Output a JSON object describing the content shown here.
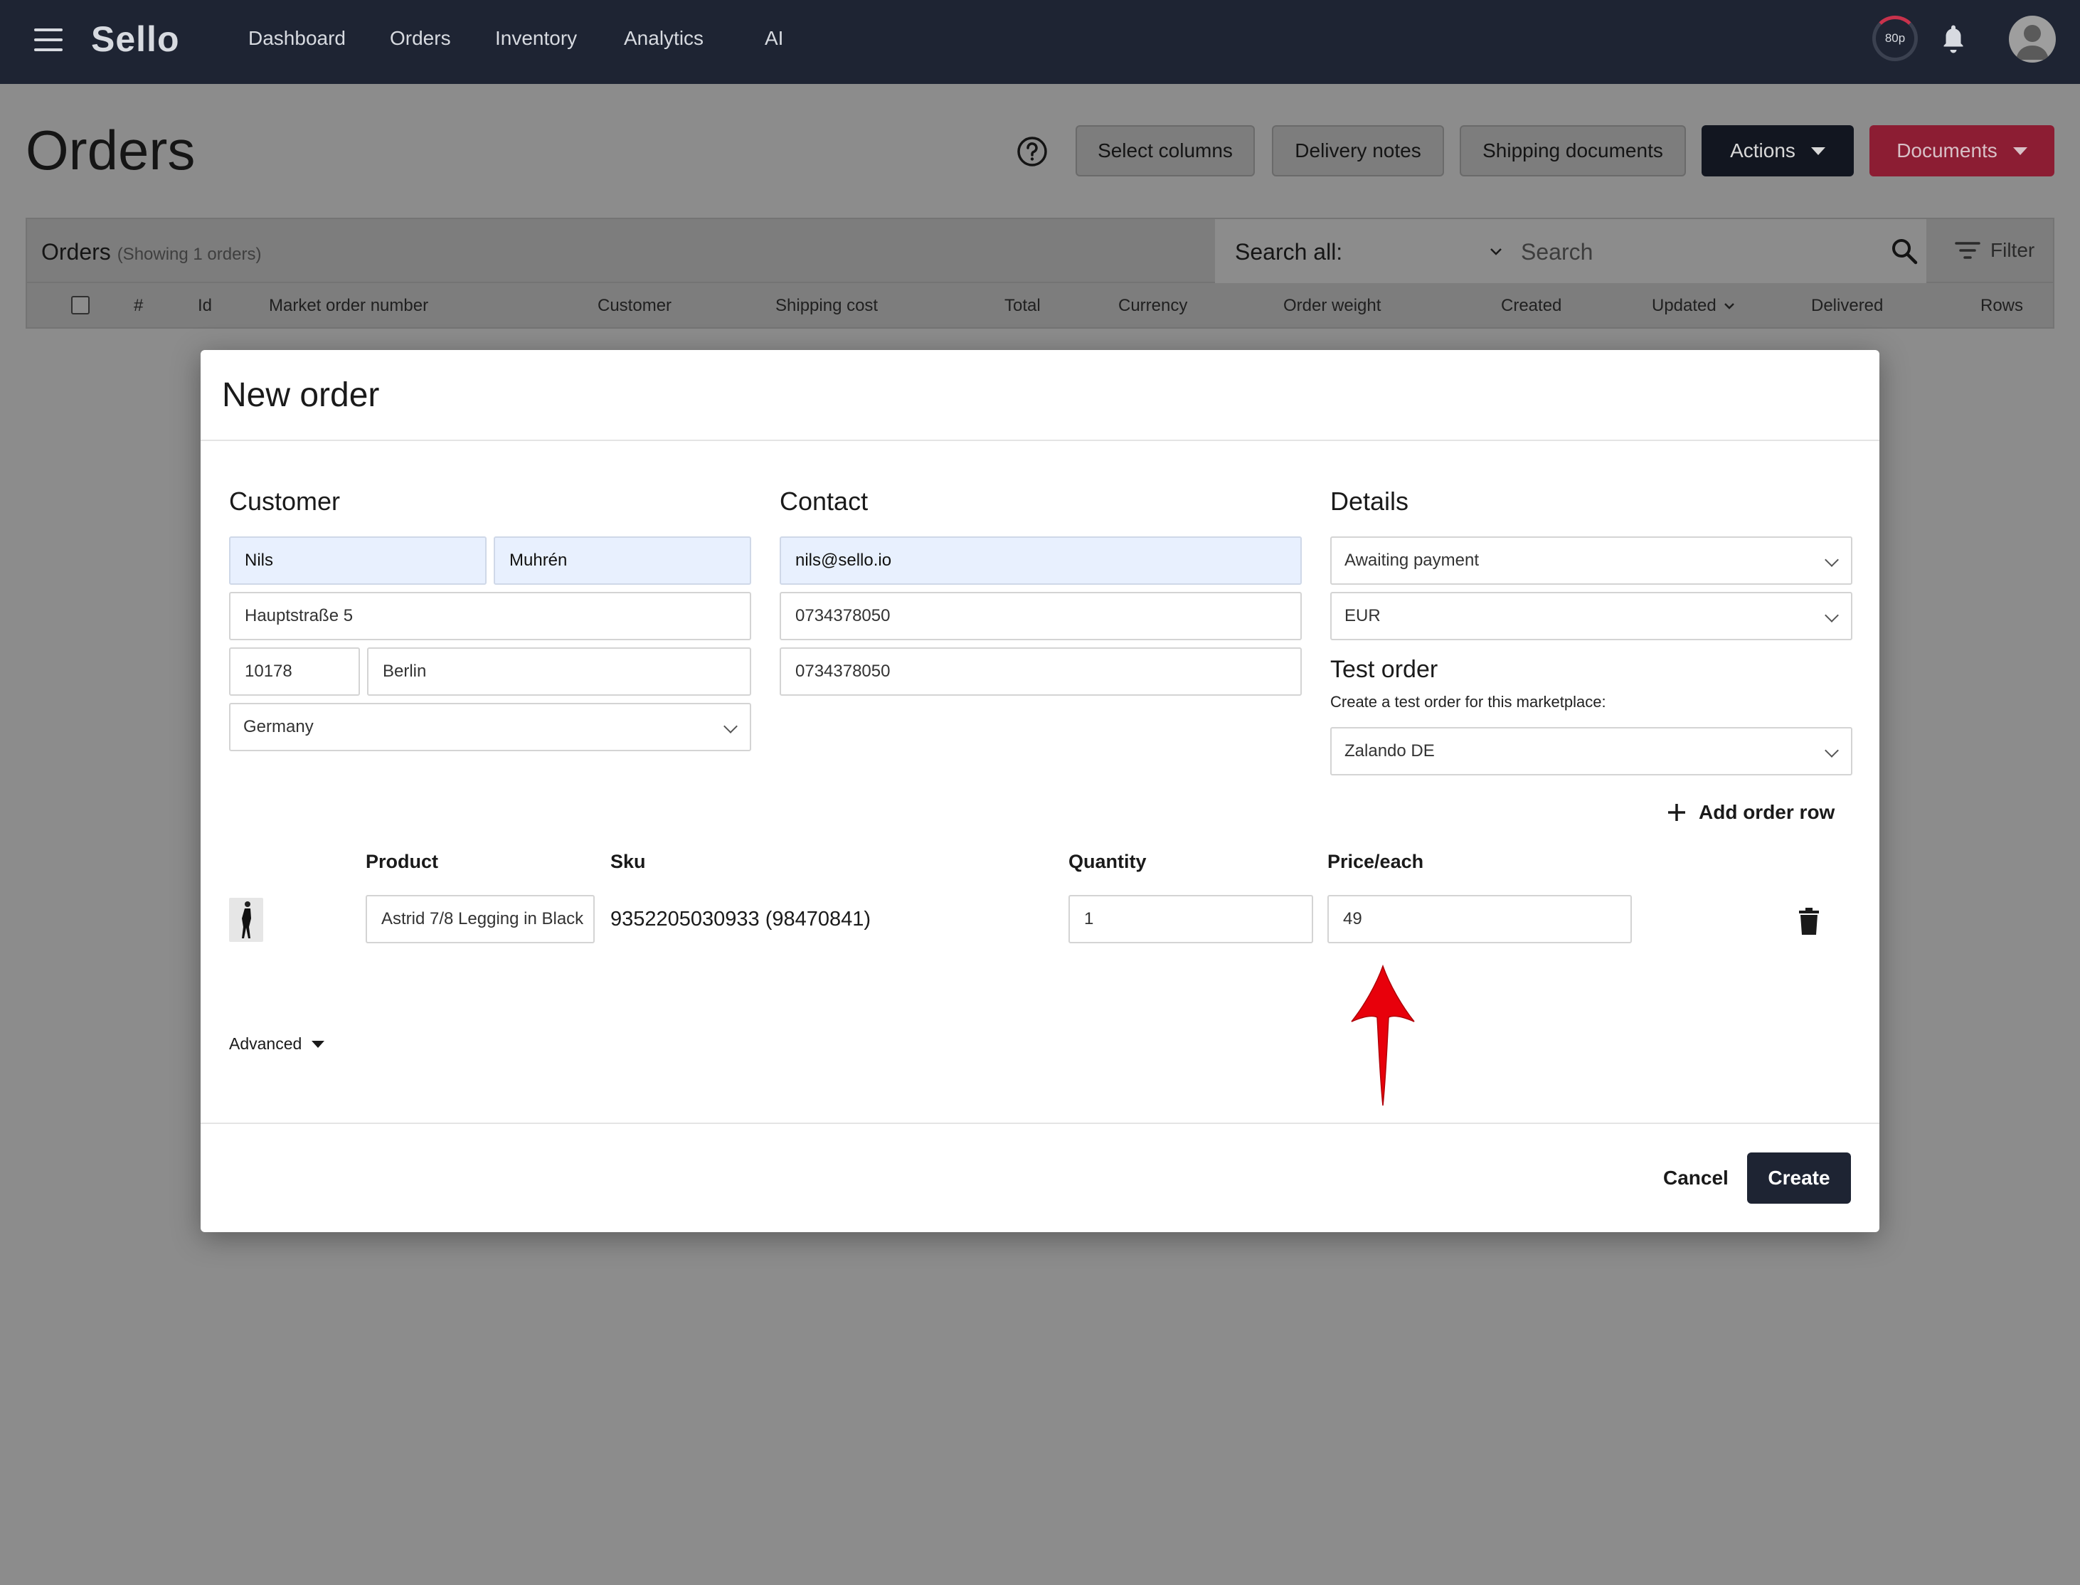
{
  "app": {
    "logo": "Sello",
    "nav": [
      "Dashboard",
      "Orders",
      "Inventory",
      "Analytics",
      "AI"
    ],
    "credits": "80p"
  },
  "page": {
    "title": "Orders",
    "buttons": {
      "select_columns": "Select columns",
      "delivery_notes": "Delivery notes",
      "shipping_documents": "Shipping documents",
      "actions": "Actions",
      "documents": "Documents"
    }
  },
  "orders_panel": {
    "label": "Orders",
    "count": "(Showing 1 orders)",
    "search_label": "Search all:",
    "search_placeholder": "Search",
    "filter": "Filter",
    "columns": [
      "#",
      "Id",
      "Market order number",
      "Customer",
      "Shipping cost",
      "Total",
      "Currency",
      "Order weight",
      "Created",
      "Updated",
      "Delivered",
      "Rows"
    ]
  },
  "modal": {
    "title": "New order",
    "customer": {
      "heading": "Customer",
      "first_name": "Nils",
      "last_name": "Muhrén",
      "street": "Hauptstraße 5",
      "zip": "10178",
      "city": "Berlin",
      "country": "Germany"
    },
    "contact": {
      "heading": "Contact",
      "email": "nils@sello.io",
      "phone": "0734378050",
      "mobile": "0734378050"
    },
    "details": {
      "heading": "Details",
      "status": "Awaiting payment",
      "currency": "EUR",
      "test_order_heading": "Test order",
      "test_order_sub": "Create a test order for this marketplace:",
      "marketplace": "Zalando DE"
    },
    "add_order_row": "Add order row",
    "row_headers": {
      "product": "Product",
      "sku": "Sku",
      "quantity": "Quantity",
      "price": "Price/each"
    },
    "row": {
      "product": "Astrid 7/8 Legging in Black",
      "sku": "9352205030933 (98470841)",
      "quantity": "1",
      "price": "49"
    },
    "advanced": "Advanced",
    "cancel": "Cancel",
    "create": "Create"
  },
  "colors": {
    "topbar": "#1e2433",
    "primary_dark": "#1e2433",
    "documents_pink": "#c8324c",
    "autofill_blue": "#e8f0fe",
    "annotation_red": "#e8000b"
  }
}
